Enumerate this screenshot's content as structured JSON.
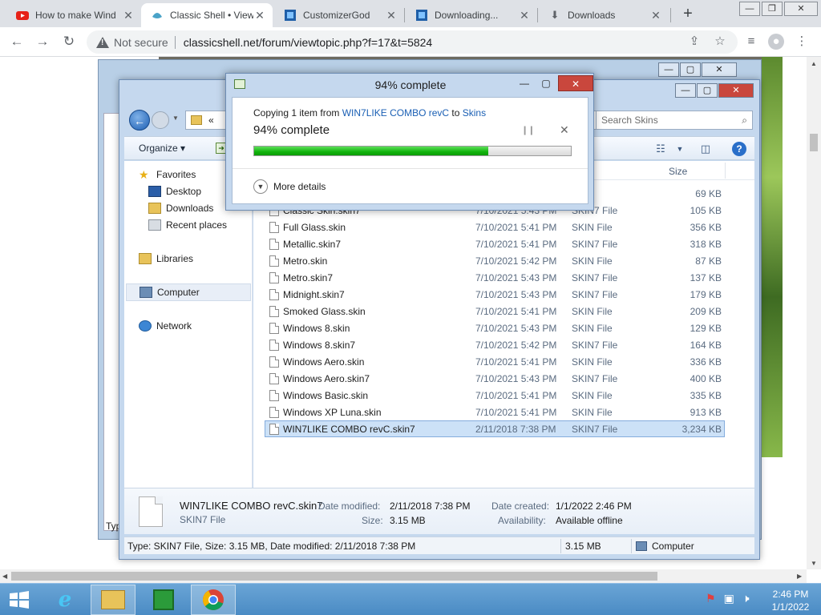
{
  "browser": {
    "tabs": [
      {
        "title": "How to make Wind",
        "icon": "youtube-icon",
        "active": false
      },
      {
        "title": "Classic Shell • View",
        "icon": "classic-shell-icon",
        "active": true
      },
      {
        "title": "CustomizerGod",
        "icon": "customizergod-icon",
        "active": false
      },
      {
        "title": "Downloading...",
        "icon": "customizergod-icon",
        "active": false
      },
      {
        "title": "Downloads",
        "icon": "download-icon",
        "active": false
      }
    ],
    "not_secure_label": "Not secure",
    "url": "classicshell.net/forum/viewtopic.php?f=17&t=5824"
  },
  "background": {
    "typ_label": "Typ"
  },
  "explorer": {
    "breadcrumb_prefix": "«",
    "search_placeholder": "Search Skins",
    "organize_label": "Organize ▾",
    "column_size": "Size",
    "nav": {
      "favorites": "Favorites",
      "desktop": "Desktop",
      "downloads": "Downloads",
      "recent_places": "Recent places",
      "libraries": "Libraries",
      "computer": "Computer",
      "network": "Network"
    },
    "files": [
      {
        "name": "",
        "date": "",
        "type": "File",
        "size": "69 KB",
        "partial": "top"
      },
      {
        "name": "Classic Skin.skin7",
        "date": "7/10/2021 5:43 PM",
        "type": "SKIN7 File",
        "size": "105 KB",
        "partial": "cut"
      },
      {
        "name": "Full Glass.skin",
        "date": "7/10/2021 5:41 PM",
        "type": "SKIN File",
        "size": "356 KB"
      },
      {
        "name": "Metallic.skin7",
        "date": "7/10/2021 5:41 PM",
        "type": "SKIN7 File",
        "size": "318 KB"
      },
      {
        "name": "Metro.skin",
        "date": "7/10/2021 5:42 PM",
        "type": "SKIN File",
        "size": "87 KB"
      },
      {
        "name": "Metro.skin7",
        "date": "7/10/2021 5:43 PM",
        "type": "SKIN7 File",
        "size": "137 KB"
      },
      {
        "name": "Midnight.skin7",
        "date": "7/10/2021 5:43 PM",
        "type": "SKIN7 File",
        "size": "179 KB"
      },
      {
        "name": "Smoked Glass.skin",
        "date": "7/10/2021 5:41 PM",
        "type": "SKIN File",
        "size": "209 KB"
      },
      {
        "name": "Windows 8.skin",
        "date": "7/10/2021 5:43 PM",
        "type": "SKIN File",
        "size": "129 KB"
      },
      {
        "name": "Windows 8.skin7",
        "date": "7/10/2021 5:42 PM",
        "type": "SKIN7 File",
        "size": "164 KB"
      },
      {
        "name": "Windows Aero.skin",
        "date": "7/10/2021 5:41 PM",
        "type": "SKIN File",
        "size": "336 KB"
      },
      {
        "name": "Windows Aero.skin7",
        "date": "7/10/2021 5:43 PM",
        "type": "SKIN7 File",
        "size": "400 KB"
      },
      {
        "name": "Windows Basic.skin",
        "date": "7/10/2021 5:41 PM",
        "type": "SKIN File",
        "size": "335 KB"
      },
      {
        "name": "Windows XP Luna.skin",
        "date": "7/10/2021 5:41 PM",
        "type": "SKIN File",
        "size": "913 KB"
      },
      {
        "name": "WIN7LIKE COMBO revC.skin7",
        "date": "2/11/2018 7:38 PM",
        "type": "SKIN7 File",
        "size": "3,234 KB",
        "selected": true
      }
    ],
    "details": {
      "filename": "WIN7LIKE COMBO revC.skin7",
      "filetype": "SKIN7 File",
      "date_modified_label": "Date modified:",
      "date_modified": "2/11/2018 7:38 PM",
      "size_label": "Size:",
      "size": "3.15 MB",
      "date_created_label": "Date created:",
      "date_created": "1/1/2022 2:46 PM",
      "availability_label": "Availability:",
      "availability": "Available offline"
    },
    "status": {
      "summary": "Type: SKIN7 File, Size: 3.15 MB, Date modified: 2/11/2018 7:38 PM",
      "size": "3.15 MB",
      "location": "Computer"
    }
  },
  "copy_dialog": {
    "title": "94% complete",
    "copying_prefix": "Copying 1 item from ",
    "source": "WIN7LIKE COMBO revC",
    "to_word": " to ",
    "destination": "Skins",
    "percent_text": "94% complete",
    "progress_fraction": 0.74,
    "more_details": "More details"
  },
  "taskbar": {
    "time": "2:46 PM",
    "date": "1/1/2022"
  },
  "colors": {
    "progress_green": "#11b30c",
    "link_blue": "#1a5fb4",
    "taskbar_blue": "#4a8bc4"
  }
}
